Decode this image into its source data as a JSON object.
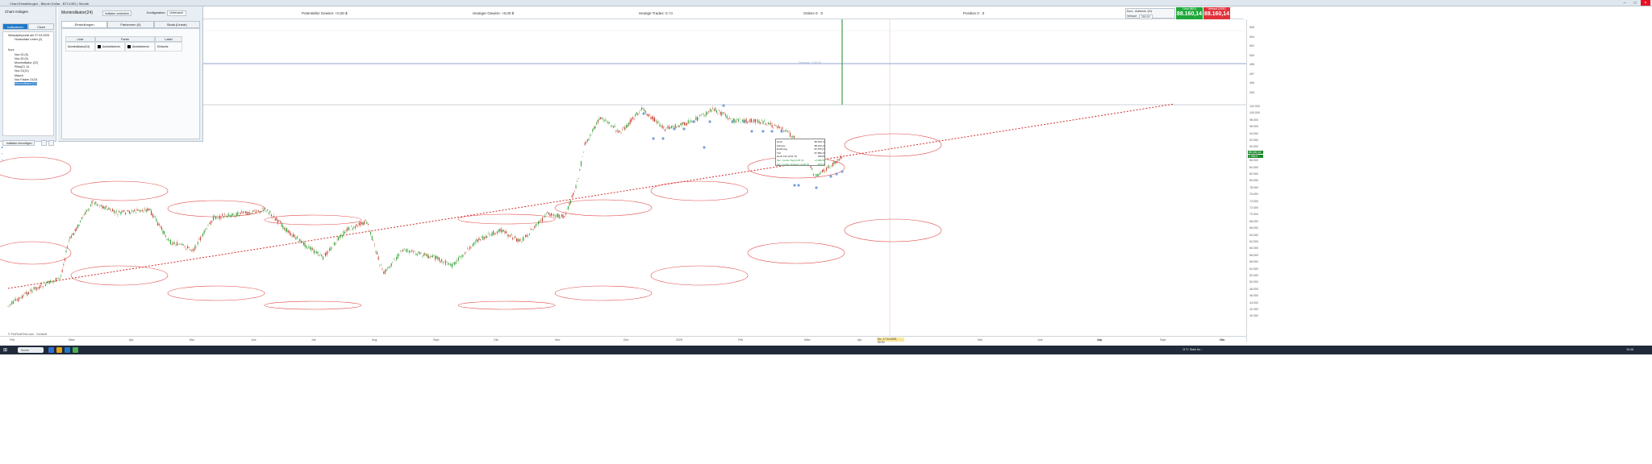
{
  "window": {
    "title": "Chart-Einstellungen - Bitcoin Dollar - BTCUSD | Stunde"
  },
  "infobar": {
    "potential": "Potentieller Gewinn: +0,00 $",
    "today": "Heutiger Gewinn: +0,00 $",
    "trades": "Heutige Trades: 0 / 0",
    "orders": "Orders 0 · 0",
    "positions": "Position 0 · 0"
  },
  "ticket": {
    "mode": "Kurz - Aufstock. (Kr)",
    "qty_label": "Verkauf",
    "qty": "250,00",
    "bid_label": "Geld (BID)",
    "bid": "88.160,14",
    "ask_label": "Verkauf (ASK)",
    "ask": "88.160,14",
    "colors": {
      "buy": "#1ea83a",
      "sell": "#e0323a"
    }
  },
  "leftpanel": {
    "title": "Chart-Anlagen",
    "tabs": [
      "Indikatoren",
      "Chart"
    ],
    "tree": [
      "Wertpapierpunkt am 07.03.2025",
      "Horizontale Linien (2)",
      "Kurs",
      "Nov 24 (5)",
      "Nov 25 (9)",
      "Momindikator (22)",
      "Pillar(21 14",
      "Nov 21(21)",
      "Mauch",
      "Nov Fäcker 21/24",
      "Momindikator(24)"
    ],
    "add_button": "Indikator hinzufügen"
  },
  "settings": {
    "heading": "Momindikator(24)",
    "change_button": "Indikator verändern",
    "config_label": "Konfiguration:",
    "config_value": "Unbenannt",
    "tabs": [
      "Einstellungen",
      "Farbzonen (0)",
      "Skala (Linear)"
    ],
    "table": {
      "headers": [
        "Linie",
        "Farbe",
        "Label"
      ],
      "rows": [
        [
          "Momindikator(24)",
          "Aufwärtstrend",
          "Abwärtstrend",
          "Einfache"
        ]
      ]
    }
  },
  "chart": {
    "copyright": "© ProRealTime.com - Echtzeit",
    "highlight_date": "Do. 17.04.2025, 00:00",
    "horizontal_label": "Zielzone : 100,00",
    "y_axis_top": [
      "505",
      "504",
      "502",
      "500",
      "498",
      "497",
      "495",
      "493"
    ],
    "y_axis_main": [
      "102.000",
      "100.000",
      "98.000",
      "96.000",
      "94.000",
      "92.000",
      "90.000",
      "88.000",
      "86.000",
      "84.000",
      "82.000",
      "80.000",
      "78.000",
      "76.000",
      "74.000",
      "72.000",
      "70.000",
      "68.000",
      "66.000",
      "64.000",
      "62.000",
      "60.000",
      "58.000",
      "56.000",
      "54.000",
      "52.000",
      "50.000",
      "48.000",
      "46.000",
      "44.000",
      "42.000",
      "40.000"
    ],
    "price_tag": "88.160,14",
    "price_tag2": "7.964,0",
    "x_labels": [
      "Feb.",
      "März",
      "Apr.",
      "Mai",
      "Juni",
      "Juli",
      "Aug.",
      "Sept.",
      "Okt.",
      "Nov.",
      "Dez.",
      "2025",
      "Feb.",
      "März",
      "Apr.",
      "Mai",
      "Juni",
      "Juli",
      "Aug.",
      "Sept.",
      "Okt.",
      "Nov."
    ],
    "tooltip": [
      [
        "Hoch",
        "88.305,14"
      ],
      [
        "Schluss",
        "88.160,14"
      ],
      [
        "Eröffnung",
        "87.876,07"
      ],
      [
        "Tief",
        "87.856,33"
      ],
      [
        "Hoch-Tief (0,51 %)",
        "448,81"
      ],
      [
        "Var. / Letzte Tag (2,45 %)",
        "+2.099,59"
      ],
      [
        "Var. / Letzte Schluss (-0,29 %)",
        "-250,05"
      ]
    ]
  },
  "taskbar": {
    "search": "Suche",
    "weather": "11°C  Stark be...",
    "time": "18:48"
  }
}
